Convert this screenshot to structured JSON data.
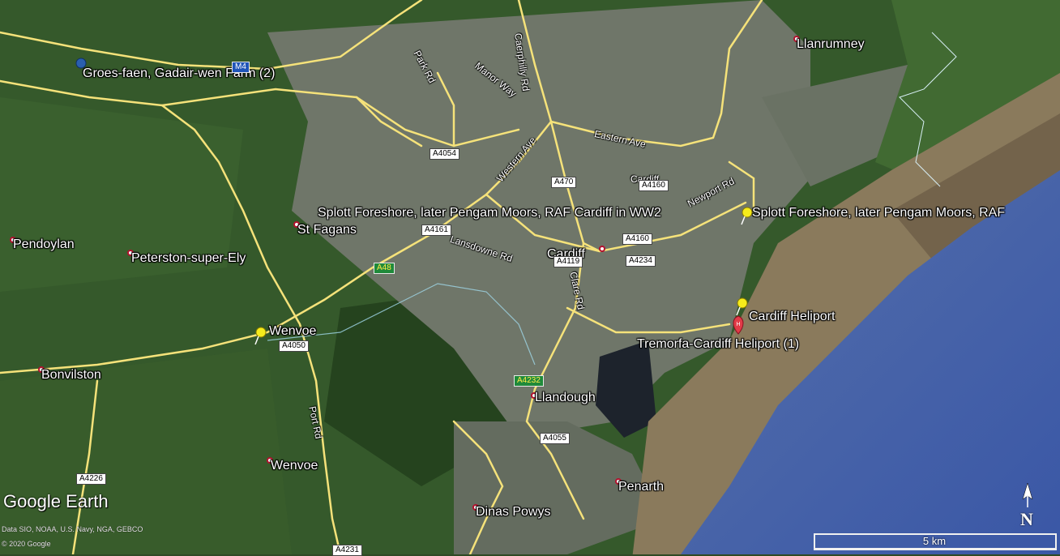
{
  "map": {
    "colors": {
      "sea": "#3f5fa8",
      "mud": "#8a7a5c",
      "fields": "#35592b",
      "urban": "#6f7669",
      "road": "#f5e27a",
      "pin_yellow": "#f6ec1b",
      "pin_red": "#e23b48"
    },
    "places": [
      {
        "name": "Llanrumney"
      },
      {
        "name": "Groes-faen, Gadair-wen Farm (2)"
      },
      {
        "name": "Splott Foreshore, later Pengam Moors, RAF Cardiff in WW2"
      },
      {
        "name": "Splott Foreshore, later Pengam Moors, RAF"
      },
      {
        "name": "St Fagans"
      },
      {
        "name": "Pendoylan"
      },
      {
        "name": "Peterston-super-Ely"
      },
      {
        "name": "Cardiff"
      },
      {
        "name": "Cardiff Heliport"
      },
      {
        "name": "Tremorfa-Cardiff Heliport (1)"
      },
      {
        "name": "Wenvoe"
      },
      {
        "name": "Bonvilston"
      },
      {
        "name": "Llandough"
      },
      {
        "name": "Wenvoe"
      },
      {
        "name": "Penarth"
      },
      {
        "name": "Dinas Powys"
      }
    ],
    "road_names": [
      {
        "name": "Park Rd"
      },
      {
        "name": "Manor Way"
      },
      {
        "name": "Caerphilly Rd"
      },
      {
        "name": "Western Ave"
      },
      {
        "name": "Eastern Ave"
      },
      {
        "name": "Cardiff"
      },
      {
        "name": "Newport Rd"
      },
      {
        "name": "Lansdowne Rd"
      },
      {
        "name": "Clare Rd"
      },
      {
        "name": "Port Rd"
      }
    ],
    "road_shields": [
      {
        "name": "M4",
        "style": "blue"
      },
      {
        "name": "A4054",
        "style": "white"
      },
      {
        "name": "A470",
        "style": "white"
      },
      {
        "name": "A4160",
        "style": "white"
      },
      {
        "name": "A4161",
        "style": "white"
      },
      {
        "name": "A4160",
        "style": "white"
      },
      {
        "name": "A4119",
        "style": "white"
      },
      {
        "name": "A4234",
        "style": "white"
      },
      {
        "name": "A48",
        "style": "green"
      },
      {
        "name": "A4050",
        "style": "white"
      },
      {
        "name": "A4232",
        "style": "green"
      },
      {
        "name": "A4055",
        "style": "white"
      },
      {
        "name": "A4226",
        "style": "white"
      },
      {
        "name": "A4231",
        "style": "white"
      }
    ]
  },
  "overlay": {
    "logo_text": "Google Earth",
    "data_credit": "Data SIO, NOAA, U.S. Navy, NGA, GEBCO",
    "copyright": "© 2020 Google",
    "scale_label": "5 km",
    "north_label": "N"
  }
}
